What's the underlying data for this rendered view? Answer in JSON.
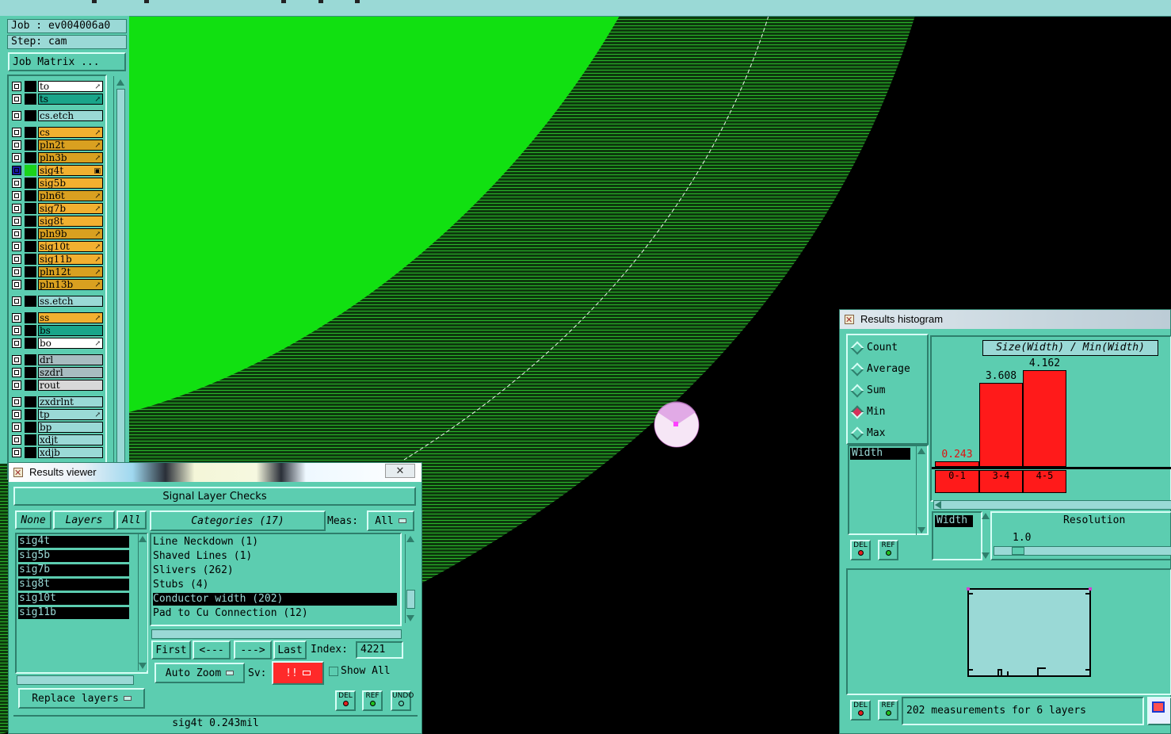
{
  "left_panel": {
    "job": "Job : ev004006a0",
    "step": "Step: cam",
    "job_matrix_button": "Job Matrix ...",
    "layers": [
      {
        "name": "to",
        "color": "#ffffff",
        "mark": "↗"
      },
      {
        "name": "ts",
        "color": "#1aa58a",
        "mark": "↗"
      },
      {
        "name": "cs.etch",
        "color": "#9ad9d6",
        "mark": ""
      },
      {
        "name": "cs",
        "color": "#f2b030",
        "mark": "↗"
      },
      {
        "name": "pln2t",
        "color": "#d9a020",
        "mark": "↗"
      },
      {
        "name": "pln3b",
        "color": "#d9a020",
        "mark": "↗"
      },
      {
        "name": "sig4t",
        "color": "#f2b030",
        "mark": "▣"
      },
      {
        "name": "sig5b",
        "color": "#f2b030",
        "mark": ""
      },
      {
        "name": "pln6t",
        "color": "#d9a020",
        "mark": "↗"
      },
      {
        "name": "sig7b",
        "color": "#f2b030",
        "mark": "↗"
      },
      {
        "name": "sig8t",
        "color": "#f2b030",
        "mark": ""
      },
      {
        "name": "pln9b",
        "color": "#d9a020",
        "mark": "↗"
      },
      {
        "name": "sig10t",
        "color": "#f2b030",
        "mark": "↗"
      },
      {
        "name": "sig11b",
        "color": "#f2b030",
        "mark": "↗"
      },
      {
        "name": "pln12t",
        "color": "#d9a020",
        "mark": "↗"
      },
      {
        "name": "pln13b",
        "color": "#d9a020",
        "mark": "↗"
      },
      {
        "name": "ss.etch",
        "color": "#9ad9d6",
        "mark": ""
      },
      {
        "name": "ss",
        "color": "#f2b030",
        "mark": "↗"
      },
      {
        "name": "bs",
        "color": "#1aa58a",
        "mark": ""
      },
      {
        "name": "bo",
        "color": "#ffffff",
        "mark": "↗"
      },
      {
        "name": "drl",
        "color": "#a8bcc0",
        "mark": ""
      },
      {
        "name": "szdrl",
        "color": "#a8bcc0",
        "mark": ""
      },
      {
        "name": "rout",
        "color": "#d8d8d8",
        "mark": ""
      },
      {
        "name": "zxdrlnt",
        "color": "#9ad9d6",
        "mark": ""
      },
      {
        "name": "tp",
        "color": "#9ad9d6",
        "mark": "↗"
      },
      {
        "name": "bp",
        "color": "#9ad9d6",
        "mark": ""
      },
      {
        "name": "xdjt",
        "color": "#9ad9d6",
        "mark": ""
      },
      {
        "name": "xdjb",
        "color": "#9ad9d6",
        "mark": ""
      }
    ]
  },
  "results_viewer": {
    "title": "Results viewer",
    "close": "✕",
    "header": "Signal Layer Checks",
    "none_btn": "None",
    "layers_btn": "Layers",
    "all_btn": "All",
    "categories_btn": "Categories (17)",
    "meas_label": "Meas:",
    "meas_value": "All",
    "layers": [
      "sig4t",
      "sig5b",
      "sig7b",
      "sig8t",
      "sig10t",
      "sig11b"
    ],
    "categories": [
      "Line Neckdown (1)",
      "Shaved Lines (1)",
      "Slivers (262)",
      "Stubs (4)",
      "Conductor width (202)",
      "Pad to Cu Connection (12)"
    ],
    "selected_category_index": 4,
    "first_btn": "First",
    "prev_btn": "<---",
    "next_btn": "--->",
    "last_btn": "Last",
    "index_label": "Index:",
    "index_value": "4221",
    "auto_zoom": "Auto Zoom",
    "sv_label": "Sv:",
    "sv_value": "!!",
    "show_all": "Show All",
    "replace_layers": "Replace layers",
    "del": "DEL",
    "ref": "REF",
    "undo": "UNDO",
    "status": "sig4t 0.243mil"
  },
  "histogram": {
    "title": "Results histogram",
    "modes": [
      "Count",
      "Average",
      "Sum",
      "Min",
      "Max"
    ],
    "selected_mode": "Min",
    "header": "Size(Width) / Min(Width)",
    "width_item": "Width",
    "width_field": "Width",
    "resolution_label": "Resolution",
    "resolution_value": "1.0",
    "del": "DEL",
    "ref": "REF",
    "summary": "202 measurements for 6 layers",
    "chart_data": {
      "type": "bar",
      "categories": [
        "0-1",
        "3-4",
        "4-5"
      ],
      "values": [
        0.243,
        3.608,
        4.162
      ],
      "ylim": [
        0,
        4.6
      ]
    }
  },
  "canvas": {
    "bg_color": "#000000",
    "fill_color": "#11e011",
    "hatch_color": "#22a022"
  }
}
